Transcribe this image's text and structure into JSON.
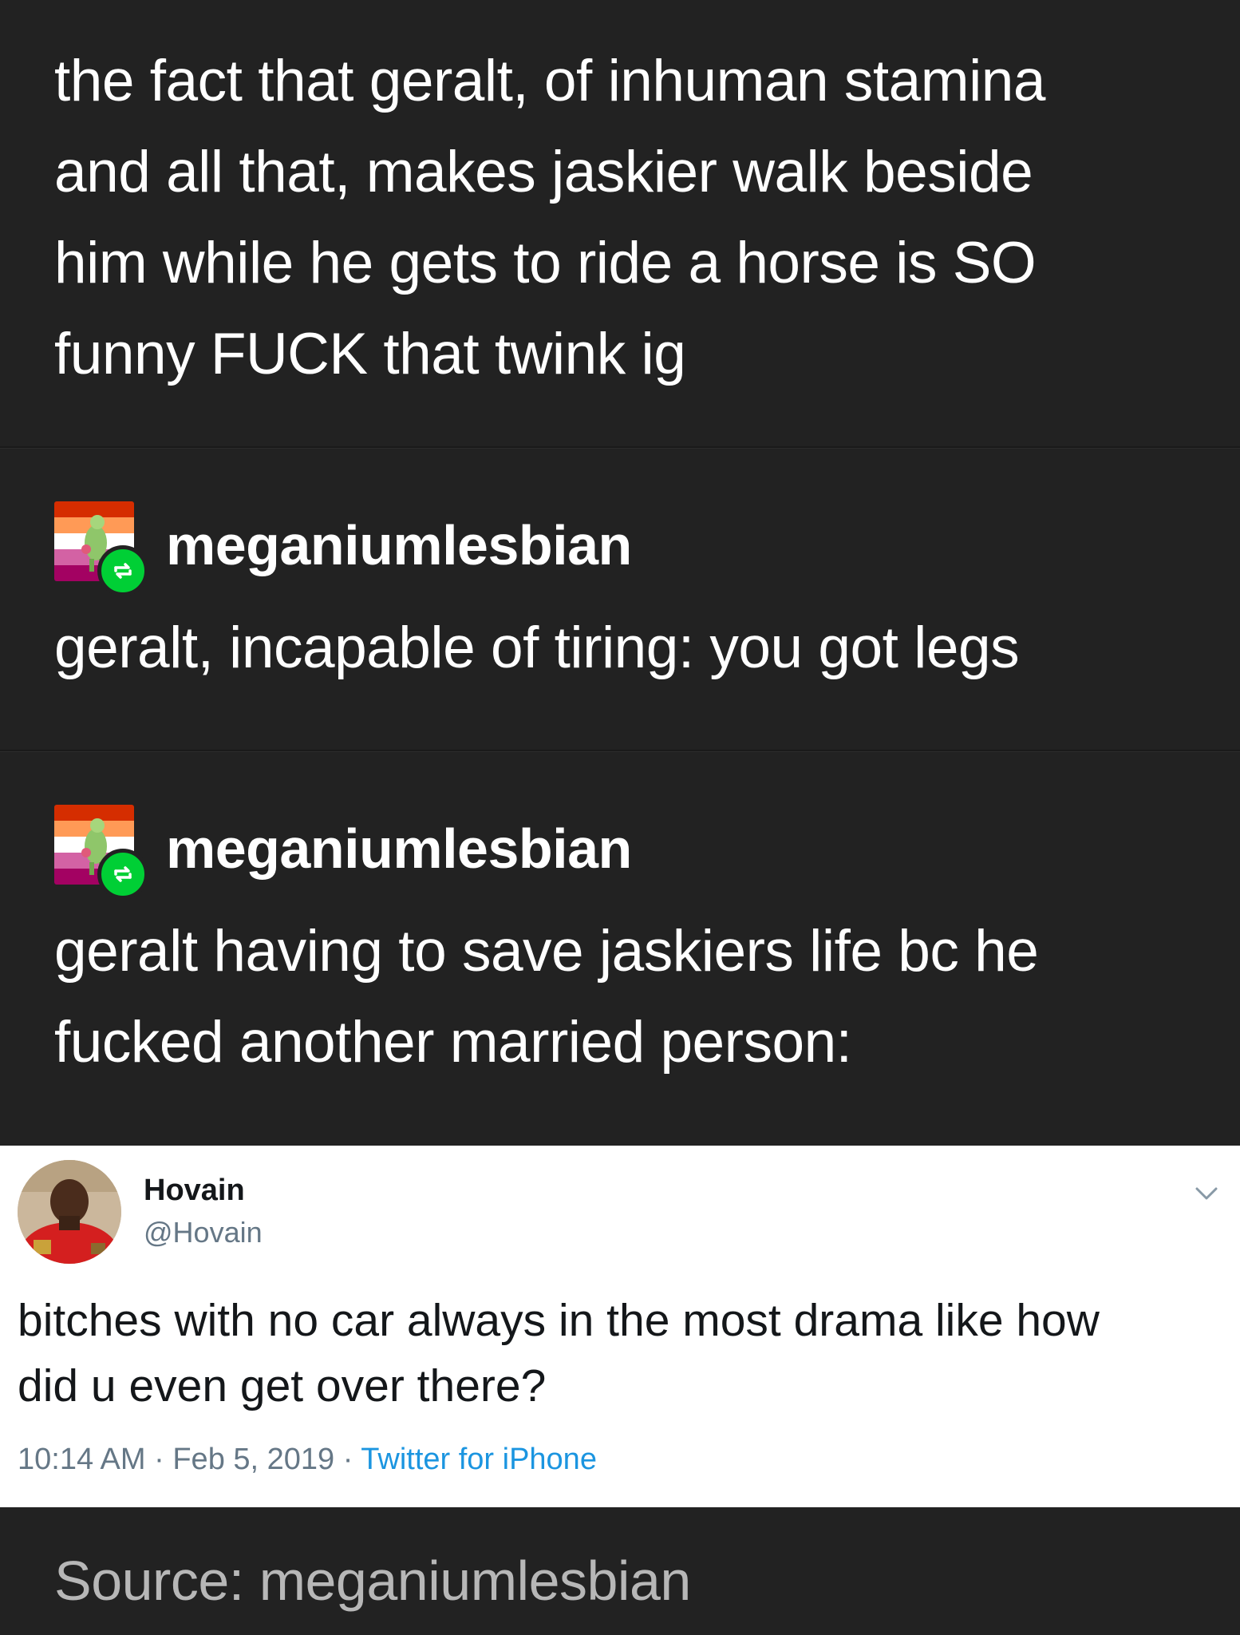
{
  "original_post": {
    "lines": [
      "the fact that geralt, of inhuman stamina",
      "and all that, makes jaskier walk beside",
      "him while he gets to ride a horse is SO",
      "funny FUCK that twink ig"
    ]
  },
  "reblogs": [
    {
      "username": "meganiumlesbian",
      "lines": [
        "geralt, incapable of tiring: you got legs"
      ]
    },
    {
      "username": "meganiumlesbian",
      "lines": [
        "geralt having to save jaskiers life bc he",
        "fucked another married person:"
      ]
    }
  ],
  "tweet": {
    "name": "Hovain",
    "handle": "@Hovain",
    "body_lines": [
      "bitches with no car always in the most drama like how",
      "did u even get over there?"
    ],
    "time": "10:14 AM",
    "separator": "·",
    "date": "Feb 5, 2019",
    "source": "Twitter for iPhone"
  },
  "footer": {
    "source_text": "Source: meganiumlesbian"
  },
  "icons": {
    "reblog_badge": "reblog-icon",
    "chevron": "chevron-down-icon"
  },
  "colors": {
    "background": "#222222",
    "reblog_green": "#00cf35",
    "twitter_blue": "#1b95e0",
    "twitter_gray": "#657786"
  }
}
